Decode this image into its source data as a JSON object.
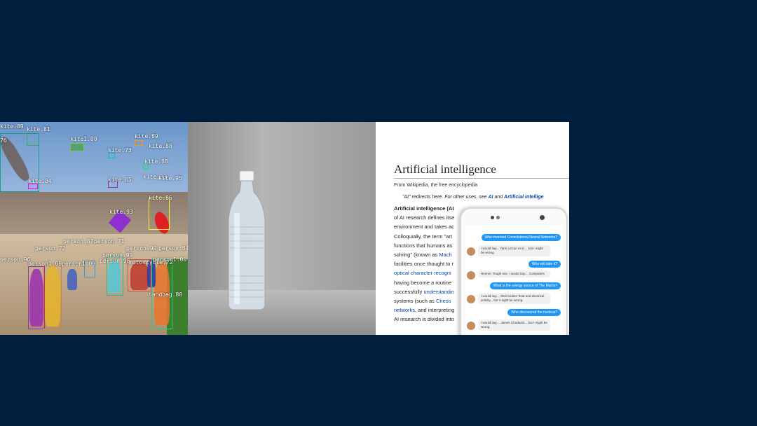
{
  "colors": {
    "background": "#001f3f"
  },
  "detection": {
    "labels": [
      "kite.89",
      "kite.81",
      "kite.76",
      "kite1.00",
      "kite.89",
      "kite.73",
      "kite.88",
      "kite.88",
      "kite.84",
      "kite.85",
      "kite.83",
      "kite.95",
      "kite.86",
      "kite.93",
      "person.72",
      "person.87",
      "person.71",
      "person.90",
      "person.84",
      "person.96",
      "person1.00",
      "person1.00",
      "person.99",
      "person.98",
      "motorcycle.72",
      "person1.00",
      "handbag.80"
    ]
  },
  "wiki": {
    "title": "Artificial intelligence",
    "subtitle": "From Wikipedia, the free encyclopedia",
    "hatnote_prefix": "\"AI\" redirects here. For other uses, see ",
    "hatnote_link1": "AI",
    "hatnote_and": " and ",
    "hatnote_link2": "Artificial intellige",
    "lines": [
      {
        "text": "Artificial intelligence (AI",
        "bold": true
      },
      {
        "text": "of AI research defines itse"
      },
      {
        "text": "environment and takes ac"
      },
      {
        "text": "Colloquially, the term \"art"
      },
      {
        "text": "functions that humans as"
      },
      {
        "text": "solving\" (known as ",
        "link": "Mach"
      },
      {
        "text": "facilities once thought to r"
      },
      {
        "text": "",
        "link": "optical character recogni"
      },
      {
        "text": "having become a routine"
      },
      {
        "text": "successfully ",
        "link": "understandin"
      },
      {
        "text": "systems (such as ",
        "link": "Chess"
      },
      {
        "text": "",
        "link": "networks",
        "after": ", and interpreting"
      },
      {
        "text": "AI research is divided into"
      }
    ]
  },
  "chat": {
    "messages": [
      {
        "dir": "out",
        "text": "Who invented Convolutional Neural Networks?"
      },
      {
        "dir": "in",
        "text": "I would say... Yann LeCun et al.... but I might be wrong."
      },
      {
        "dir": "out",
        "text": "Who will take it?"
      },
      {
        "dir": "in",
        "text": "Hmmm. Tough one. I would say.... Computers"
      },
      {
        "dir": "out",
        "text": "What is the energy source of The Matrix?"
      },
      {
        "dir": "in",
        "text": "I would say.... their bodies' heat and electrical activity... but I might be wrong."
      },
      {
        "dir": "out",
        "text": "Who discovered the nucleus?"
      },
      {
        "dir": "in",
        "text": "I would say.... James Chadwick... but I might be wrong."
      }
    ]
  }
}
